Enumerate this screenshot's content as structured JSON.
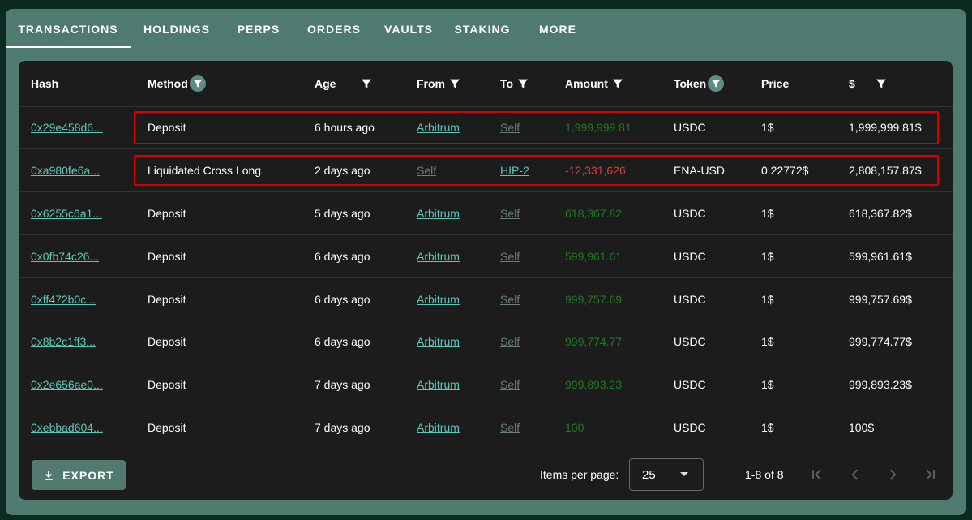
{
  "tabs": [
    {
      "label": "TRANSACTIONS",
      "active": true
    },
    {
      "label": "HOLDINGS",
      "active": false
    },
    {
      "label": "PERPS",
      "active": false
    },
    {
      "label": "ORDERS",
      "active": false
    },
    {
      "label": "VAULTS",
      "active": false
    },
    {
      "label": "STAKING",
      "active": false
    },
    {
      "label": "MORE",
      "active": false
    }
  ],
  "table": {
    "columns": [
      "Hash",
      "Method",
      "Age",
      "From",
      "To",
      "Amount",
      "Token",
      "Price",
      "$"
    ],
    "rows": [
      {
        "hash": "0x29e458d6...",
        "method": "Deposit",
        "age": "6 hours ago",
        "from": "Arbitrum",
        "to": "Self",
        "amount": "1,999,999.81",
        "token": "USDC",
        "price": "1$",
        "usd": "1,999,999.81$"
      },
      {
        "hash": "0xa980fe6a...",
        "method": "Liquidated Cross Long",
        "age": "2 days ago",
        "from": "Self",
        "to": "HIP-2",
        "amount": "-12,331,626",
        "token": "ENA-USD",
        "price": "0.22772$",
        "usd": "2,808,157.87$"
      },
      {
        "hash": "0x6255c6a1...",
        "method": "Deposit",
        "age": "5 days ago",
        "from": "Arbitrum",
        "to": "Self",
        "amount": "618,367.82",
        "token": "USDC",
        "price": "1$",
        "usd": "618,367.82$"
      },
      {
        "hash": "0x0fb74c26...",
        "method": "Deposit",
        "age": "6 days ago",
        "from": "Arbitrum",
        "to": "Self",
        "amount": "599,961.61",
        "token": "USDC",
        "price": "1$",
        "usd": "599,961.61$"
      },
      {
        "hash": "0xff472b0c...",
        "method": "Deposit",
        "age": "6 days ago",
        "from": "Arbitrum",
        "to": "Self",
        "amount": "999,757.69",
        "token": "USDC",
        "price": "1$",
        "usd": "999,757.69$"
      },
      {
        "hash": "0x8b2c1ff3...",
        "method": "Deposit",
        "age": "6 days ago",
        "from": "Arbitrum",
        "to": "Self",
        "amount": "999,774.77",
        "token": "USDC",
        "price": "1$",
        "usd": "999,774.77$"
      },
      {
        "hash": "0x2e656ae0...",
        "method": "Deposit",
        "age": "7 days ago",
        "from": "Arbitrum",
        "to": "Self",
        "amount": "999,893.23",
        "token": "USDC",
        "price": "1$",
        "usd": "999,893.23$"
      },
      {
        "hash": "0xebbad604...",
        "method": "Deposit",
        "age": "7 days ago",
        "from": "Arbitrum",
        "to": "Self",
        "amount": "100",
        "token": "USDC",
        "price": "1$",
        "usd": "100$"
      }
    ]
  },
  "footer": {
    "export_label": "EXPORT",
    "items_per_page_label": "Items per page:",
    "items_per_page_value": "25",
    "range_text": "1-8 of 8"
  },
  "colors": {
    "accent": "#5ec8b6",
    "positive": "#1f7a24",
    "negative": "#e23b3b",
    "highlight": "#d50000"
  },
  "icons": [
    "filter-icon",
    "download-icon",
    "chevron-down-icon",
    "first-page-icon",
    "prev-page-icon",
    "next-page-icon",
    "last-page-icon"
  ]
}
